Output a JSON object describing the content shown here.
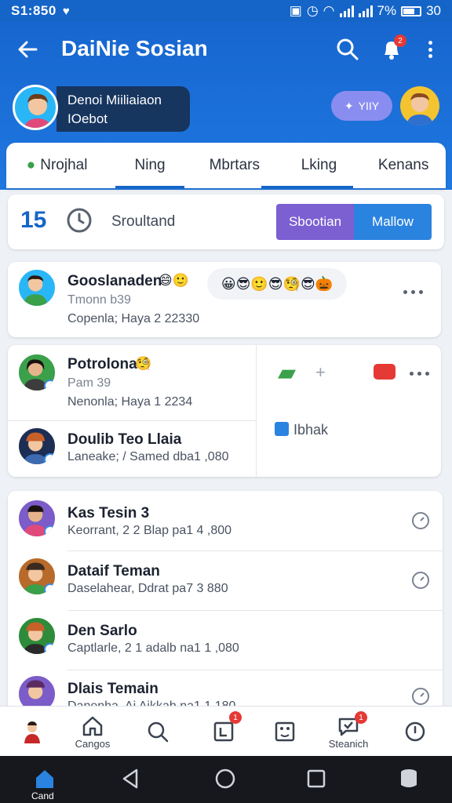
{
  "status_bar": {
    "time": "S1:850",
    "battery": "7%",
    "clock_right": "30"
  },
  "header": {
    "title": "DaiNie Sosian"
  },
  "profile": {
    "line1": "Denoi Miiliaiaon",
    "line2": "IOebot"
  },
  "pill_button": {
    "label": "YIIY"
  },
  "tabs": [
    {
      "label": "Nrojhal"
    },
    {
      "label": "Ning"
    },
    {
      "label": "Mbrtars"
    },
    {
      "label": "Lking"
    },
    {
      "label": "Kenans"
    }
  ],
  "toolbar": {
    "count": "15",
    "label": "Sroultand",
    "segment_left": "Sbootian",
    "segment_right": "Mallow"
  },
  "featured": {
    "name": "Gooslanaden",
    "line1": "Tmonn b39",
    "line2": "Copenla; Haya 2 22330"
  },
  "split_card": {
    "items": [
      {
        "name": "Potrolona",
        "line1": "Pam 39",
        "line2": "Nenonla; Haya 1 2234"
      },
      {
        "name": "Doulib Teo Llaia",
        "line2": "Laneake; / Samed dba1 ,080"
      }
    ],
    "side_label": "Ibhak"
  },
  "contacts": [
    {
      "name": "Kas Tesin 3",
      "sub": "Keorrant, 2 2 Blap pa1 4 ,800"
    },
    {
      "name": "Dataif Teman",
      "sub": "Daselahear, Ddrat pa7 3 880"
    },
    {
      "name": "Den Sarlo",
      "sub": "Captlarle, 2 1 adalb na1 1 ,080"
    },
    {
      "name": "Dlais Temain",
      "sub": "Danenha, Ai Aikkah na1 1 180"
    }
  ],
  "bottom_nav": [
    {
      "label": ""
    },
    {
      "label": "Cangos"
    },
    {
      "label": ""
    },
    {
      "label": ""
    },
    {
      "label": ""
    },
    {
      "label": "Steanich"
    },
    {
      "label": ""
    }
  ],
  "system_nav": {
    "home_label": "Cand"
  },
  "colors": {
    "primary": "#1565c8",
    "accent_purple": "#7c5fd1",
    "badge_red": "#e53935"
  }
}
